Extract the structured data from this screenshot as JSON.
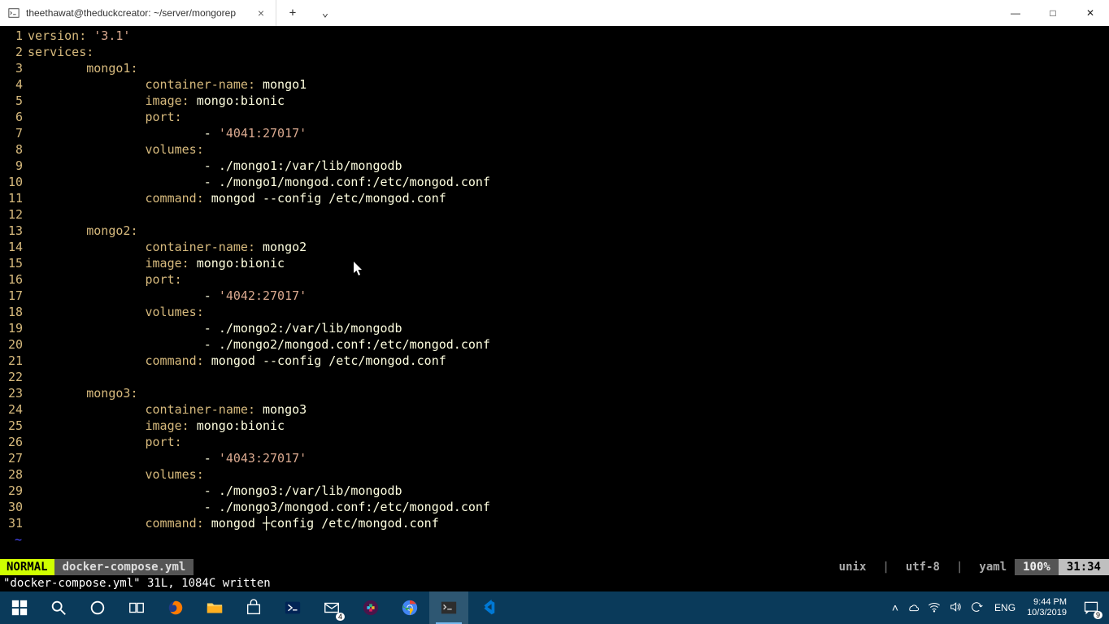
{
  "titlebar": {
    "tab_title": "theethawat@theduckcreator: ~/server/mongorep",
    "tab_close": "×",
    "new_tab": "+",
    "chevron": "⌄",
    "minimize": "—",
    "maximize": "□",
    "close": "✕"
  },
  "code_lines": [
    {
      "n": "1",
      "tokens": [
        {
          "c": "key",
          "t": "version"
        },
        {
          "c": "colon",
          "t": ":"
        },
        {
          "c": "",
          "t": " "
        },
        {
          "c": "str",
          "t": "'3.1'"
        }
      ]
    },
    {
      "n": "2",
      "tokens": [
        {
          "c": "key",
          "t": "services"
        },
        {
          "c": "colon",
          "t": ":"
        }
      ]
    },
    {
      "n": "3",
      "tokens": [
        {
          "c": "",
          "t": "        "
        },
        {
          "c": "key",
          "t": "mongo1"
        },
        {
          "c": "colon",
          "t": ":"
        }
      ]
    },
    {
      "n": "4",
      "tokens": [
        {
          "c": "",
          "t": "                "
        },
        {
          "c": "key",
          "t": "container-name"
        },
        {
          "c": "colon",
          "t": ":"
        },
        {
          "c": "",
          "t": " "
        },
        {
          "c": "val",
          "t": "mongo1"
        }
      ]
    },
    {
      "n": "5",
      "tokens": [
        {
          "c": "",
          "t": "                "
        },
        {
          "c": "key",
          "t": "image"
        },
        {
          "c": "colon",
          "t": ":"
        },
        {
          "c": "",
          "t": " "
        },
        {
          "c": "val",
          "t": "mongo:bionic"
        }
      ]
    },
    {
      "n": "6",
      "tokens": [
        {
          "c": "",
          "t": "                "
        },
        {
          "c": "key",
          "t": "port"
        },
        {
          "c": "colon",
          "t": ":"
        }
      ]
    },
    {
      "n": "7",
      "tokens": [
        {
          "c": "",
          "t": "                        "
        },
        {
          "c": "dash",
          "t": "-"
        },
        {
          "c": "",
          "t": " "
        },
        {
          "c": "str",
          "t": "'4041:27017'"
        }
      ]
    },
    {
      "n": "8",
      "tokens": [
        {
          "c": "",
          "t": "                "
        },
        {
          "c": "key",
          "t": "volumes"
        },
        {
          "c": "colon",
          "t": ":"
        }
      ]
    },
    {
      "n": "9",
      "tokens": [
        {
          "c": "",
          "t": "                        "
        },
        {
          "c": "dash",
          "t": "-"
        },
        {
          "c": "",
          "t": " "
        },
        {
          "c": "val",
          "t": "./mongo1:/var/lib/mongodb"
        }
      ]
    },
    {
      "n": "10",
      "tokens": [
        {
          "c": "",
          "t": "                        "
        },
        {
          "c": "dash",
          "t": "-"
        },
        {
          "c": "",
          "t": " "
        },
        {
          "c": "val",
          "t": "./mongo1/mongod.conf:/etc/mongod.conf"
        }
      ]
    },
    {
      "n": "11",
      "tokens": [
        {
          "c": "",
          "t": "                "
        },
        {
          "c": "key",
          "t": "command"
        },
        {
          "c": "colon",
          "t": ":"
        },
        {
          "c": "",
          "t": " "
        },
        {
          "c": "cmd",
          "t": "mongod --config /etc/mongod.conf"
        }
      ]
    },
    {
      "n": "12",
      "tokens": []
    },
    {
      "n": "13",
      "tokens": [
        {
          "c": "",
          "t": "        "
        },
        {
          "c": "key",
          "t": "mongo2"
        },
        {
          "c": "colon",
          "t": ":"
        }
      ]
    },
    {
      "n": "14",
      "tokens": [
        {
          "c": "",
          "t": "                "
        },
        {
          "c": "key",
          "t": "container-name"
        },
        {
          "c": "colon",
          "t": ":"
        },
        {
          "c": "",
          "t": " "
        },
        {
          "c": "val",
          "t": "mongo2"
        }
      ]
    },
    {
      "n": "15",
      "tokens": [
        {
          "c": "",
          "t": "                "
        },
        {
          "c": "key",
          "t": "image"
        },
        {
          "c": "colon",
          "t": ":"
        },
        {
          "c": "",
          "t": " "
        },
        {
          "c": "val",
          "t": "mongo:bionic"
        }
      ]
    },
    {
      "n": "16",
      "tokens": [
        {
          "c": "",
          "t": "                "
        },
        {
          "c": "key",
          "t": "port"
        },
        {
          "c": "colon",
          "t": ":"
        }
      ]
    },
    {
      "n": "17",
      "tokens": [
        {
          "c": "",
          "t": "                        "
        },
        {
          "c": "dash",
          "t": "-"
        },
        {
          "c": "",
          "t": " "
        },
        {
          "c": "str",
          "t": "'4042:27017'"
        }
      ]
    },
    {
      "n": "18",
      "tokens": [
        {
          "c": "",
          "t": "                "
        },
        {
          "c": "key",
          "t": "volumes"
        },
        {
          "c": "colon",
          "t": ":"
        }
      ]
    },
    {
      "n": "19",
      "tokens": [
        {
          "c": "",
          "t": "                        "
        },
        {
          "c": "dash",
          "t": "-"
        },
        {
          "c": "",
          "t": " "
        },
        {
          "c": "val",
          "t": "./mongo2:/var/lib/mongodb"
        }
      ]
    },
    {
      "n": "20",
      "tokens": [
        {
          "c": "",
          "t": "                        "
        },
        {
          "c": "dash",
          "t": "-"
        },
        {
          "c": "",
          "t": " "
        },
        {
          "c": "val",
          "t": "./mongo2/mongod.conf:/etc/mongod.conf"
        }
      ]
    },
    {
      "n": "21",
      "tokens": [
        {
          "c": "",
          "t": "                "
        },
        {
          "c": "key",
          "t": "command"
        },
        {
          "c": "colon",
          "t": ":"
        },
        {
          "c": "",
          "t": " "
        },
        {
          "c": "cmd",
          "t": "mongod --config /etc/mongod.conf"
        }
      ]
    },
    {
      "n": "22",
      "tokens": []
    },
    {
      "n": "23",
      "tokens": [
        {
          "c": "",
          "t": "        "
        },
        {
          "c": "key",
          "t": "mongo3"
        },
        {
          "c": "colon",
          "t": ":"
        }
      ]
    },
    {
      "n": "24",
      "tokens": [
        {
          "c": "",
          "t": "                "
        },
        {
          "c": "key",
          "t": "container-name"
        },
        {
          "c": "colon",
          "t": ":"
        },
        {
          "c": "",
          "t": " "
        },
        {
          "c": "val",
          "t": "mongo3"
        }
      ]
    },
    {
      "n": "25",
      "tokens": [
        {
          "c": "",
          "t": "                "
        },
        {
          "c": "key",
          "t": "image"
        },
        {
          "c": "colon",
          "t": ":"
        },
        {
          "c": "",
          "t": " "
        },
        {
          "c": "val",
          "t": "mongo:bionic"
        }
      ]
    },
    {
      "n": "26",
      "tokens": [
        {
          "c": "",
          "t": "                "
        },
        {
          "c": "key",
          "t": "port"
        },
        {
          "c": "colon",
          "t": ":"
        }
      ]
    },
    {
      "n": "27",
      "tokens": [
        {
          "c": "",
          "t": "                        "
        },
        {
          "c": "dash",
          "t": "-"
        },
        {
          "c": "",
          "t": " "
        },
        {
          "c": "str",
          "t": "'4043:27017'"
        }
      ]
    },
    {
      "n": "28",
      "tokens": [
        {
          "c": "",
          "t": "                "
        },
        {
          "c": "key",
          "t": "volumes"
        },
        {
          "c": "colon",
          "t": ":"
        }
      ]
    },
    {
      "n": "29",
      "tokens": [
        {
          "c": "",
          "t": "                        "
        },
        {
          "c": "dash",
          "t": "-"
        },
        {
          "c": "",
          "t": " "
        },
        {
          "c": "val",
          "t": "./mongo3:/var/lib/mongodb"
        }
      ]
    },
    {
      "n": "30",
      "tokens": [
        {
          "c": "",
          "t": "                        "
        },
        {
          "c": "dash",
          "t": "-"
        },
        {
          "c": "",
          "t": " "
        },
        {
          "c": "val",
          "t": "./mongo3/mongod.conf:/etc/mongod.conf"
        }
      ]
    },
    {
      "n": "31",
      "tokens": [
        {
          "c": "",
          "t": "                "
        },
        {
          "c": "key",
          "t": "command"
        },
        {
          "c": "colon",
          "t": ":"
        },
        {
          "c": "",
          "t": " "
        },
        {
          "c": "cmd",
          "t": "mongod ┼config /etc/mongod.conf"
        }
      ]
    }
  ],
  "tilde": "~",
  "status": {
    "mode": "NORMAL",
    "filename": "docker-compose.yml",
    "right_unix": "unix",
    "right_enc": "utf-8",
    "right_ft": "yaml",
    "pct": "100%",
    "pos": "31:34",
    "sep": "|",
    "message": "\"docker-compose.yml\" 31L, 1084C written"
  },
  "taskbar": {
    "lang": "ENG",
    "time": "9:44 PM",
    "date": "10/3/2019",
    "notif_count": "9",
    "tray_up": "˄"
  }
}
